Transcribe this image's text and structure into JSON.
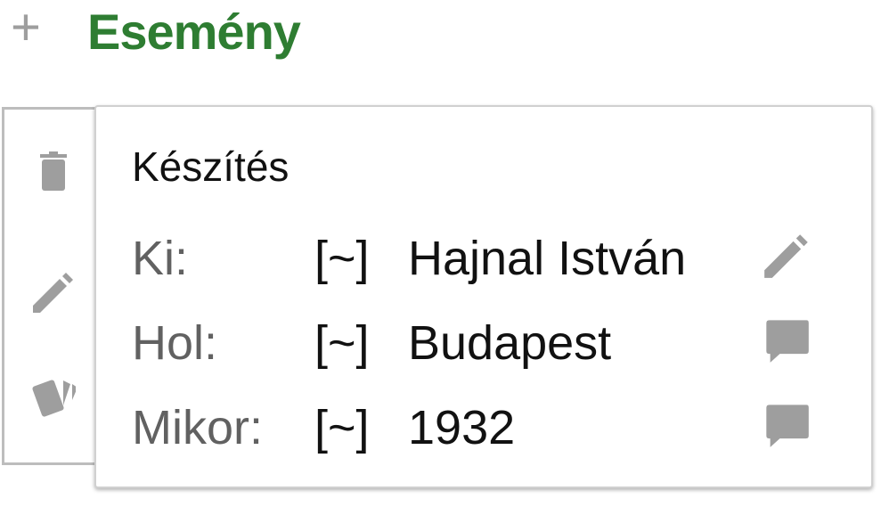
{
  "header": {
    "add_icon": "plus-icon",
    "title": "Esemény"
  },
  "sidebar": {
    "icons": [
      "trash-icon",
      "pencil-icon",
      "cards-icon"
    ]
  },
  "card": {
    "title": "Készítés",
    "rows": [
      {
        "label": "Ki:",
        "certainty": "[~]",
        "value": "Hajnal István",
        "icon": "pencil-icon"
      },
      {
        "label": "Hol:",
        "certainty": "[~]",
        "value": "Budapest",
        "icon": "comment-icon"
      },
      {
        "label": "Mikor:",
        "certainty": "[~]",
        "value": "1932",
        "icon": "comment-icon"
      }
    ]
  },
  "colors": {
    "title": "#2e7d32",
    "icon": "#9e9e9e",
    "label": "#616161"
  }
}
